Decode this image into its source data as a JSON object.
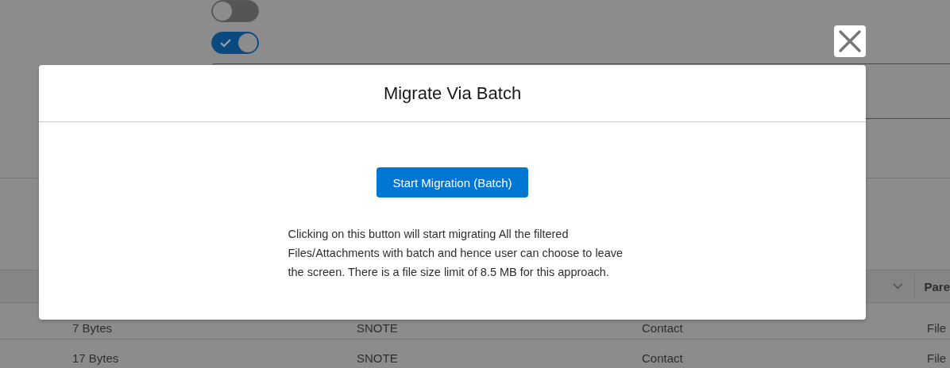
{
  "background": {
    "toggles": [
      {
        "on": false
      },
      {
        "on": true
      }
    ],
    "table": {
      "header": {
        "column_5": "Pare"
      },
      "rows": [
        {
          "cells": [
            "7 Bytes",
            "SNOTE",
            "Contact",
            "File"
          ]
        },
        {
          "cells": [
            "17 Bytes",
            "SNOTE",
            "Contact",
            "File"
          ]
        }
      ]
    }
  },
  "modal": {
    "title": "Migrate Via Batch",
    "button": "Start Migration (Batch)",
    "description": "Clicking on this button will start migrating All the filtered Files/Attachments with batch and hence user can choose to leave the screen. There is a file size limit of 8.5 MB for this approach."
  }
}
